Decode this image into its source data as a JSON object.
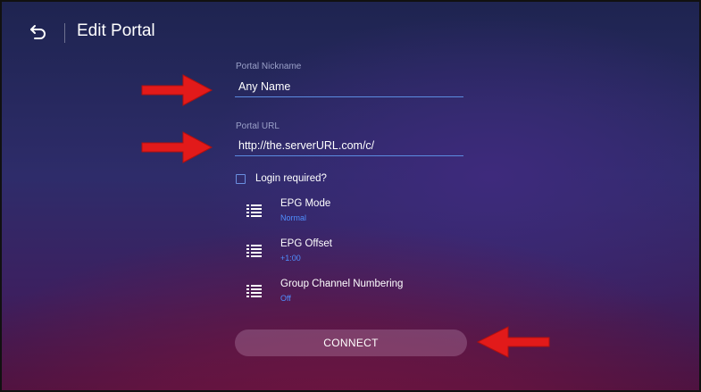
{
  "header": {
    "title": "Edit Portal",
    "back_icon": "back-arrow-icon"
  },
  "form": {
    "nickname": {
      "label": "Portal Nickname",
      "value": "Any Name"
    },
    "url": {
      "label": "Portal URL",
      "value": "http://the.serverURL.com/c/"
    },
    "login_required": {
      "label": "Login required?",
      "checked": false
    }
  },
  "settings": [
    {
      "title": "EPG Mode",
      "value": "Normal",
      "icon": "list-icon"
    },
    {
      "title": "EPG Offset",
      "value": "+1:00",
      "icon": "list-icon"
    },
    {
      "title": "Group Channel Numbering",
      "value": "Off",
      "icon": "list-icon"
    }
  ],
  "connect_label": "CONNECT",
  "colors": {
    "accent": "#4f8fff",
    "arrow": "#e21a1a",
    "underline": "#5b8be0"
  }
}
